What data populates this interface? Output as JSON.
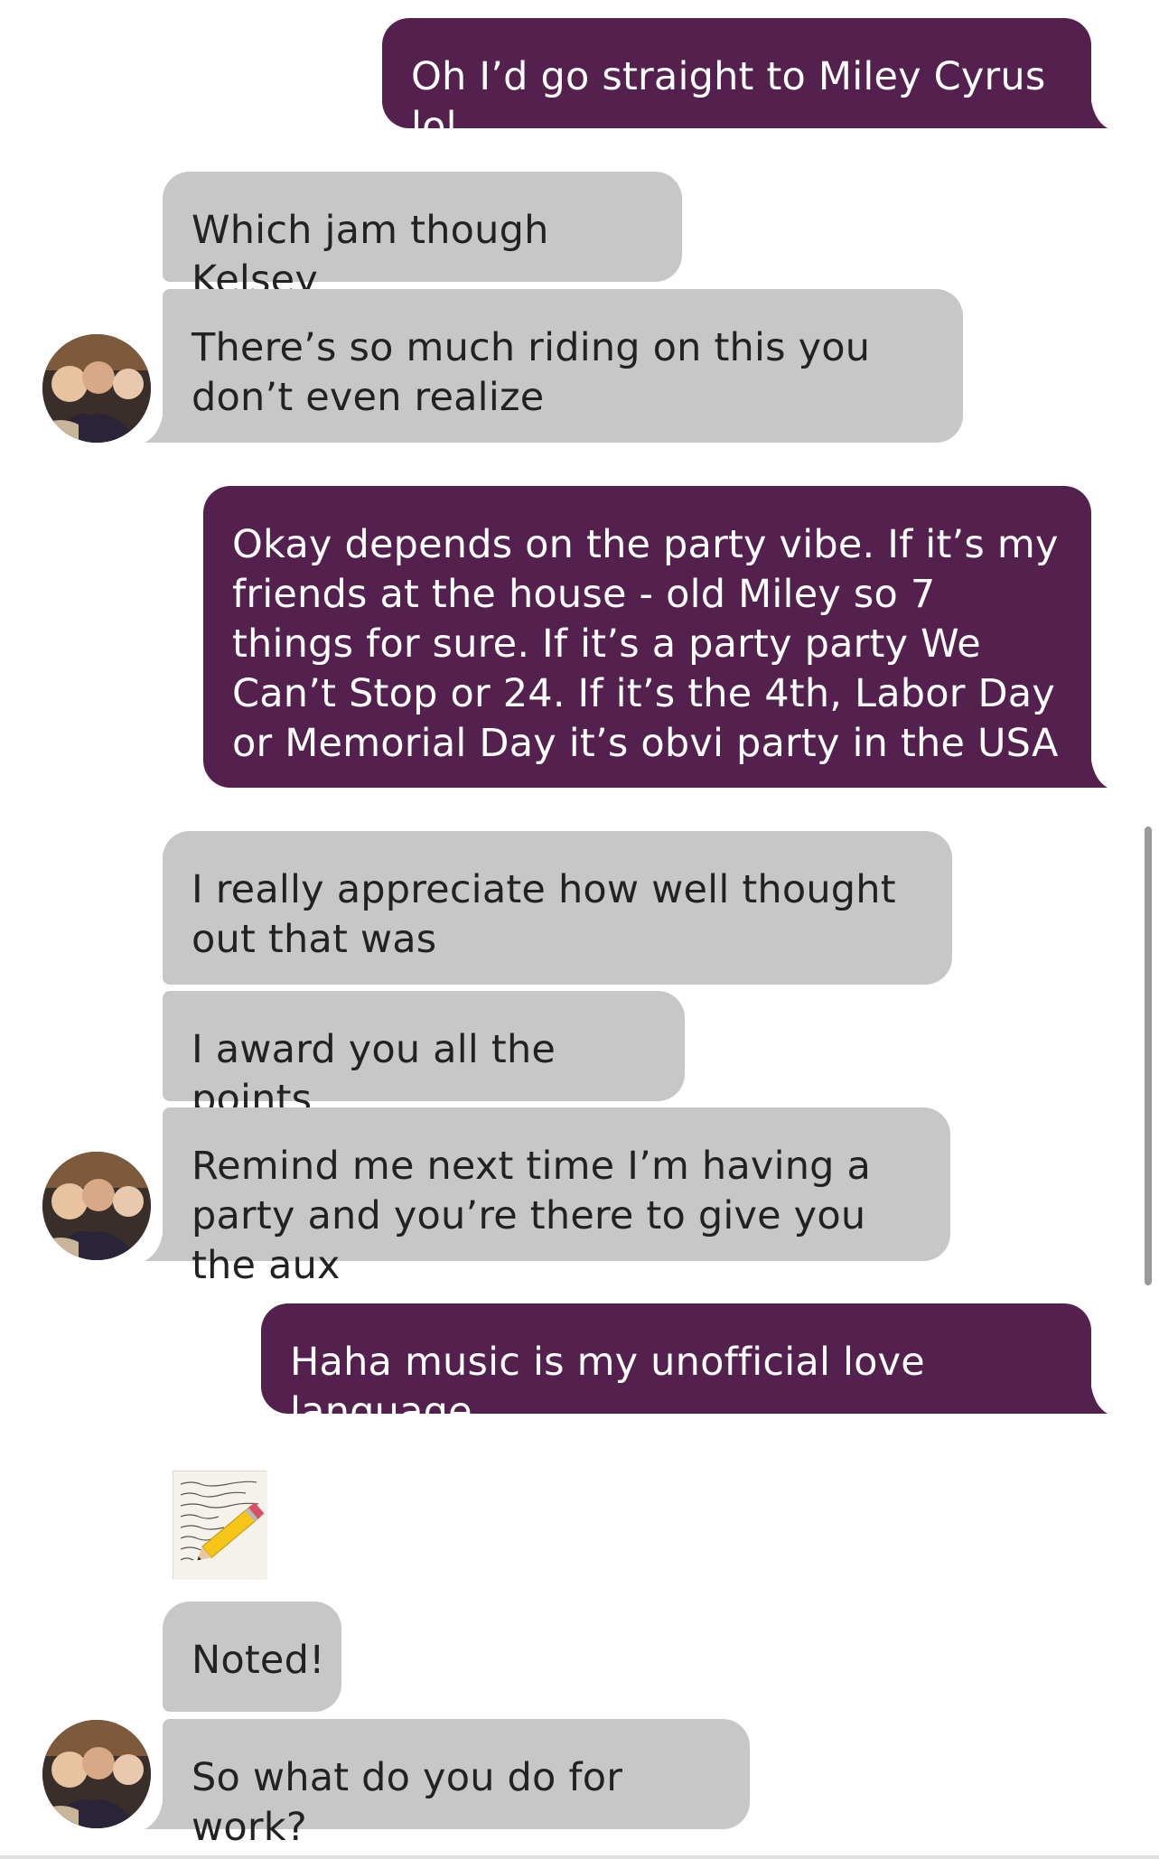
{
  "conversation": {
    "messages": [
      {
        "from": "me",
        "text": "Oh I’d go straight to Miley Cyrus lol"
      },
      {
        "from": "them",
        "text": "Which jam though Kelsey"
      },
      {
        "from": "them",
        "text": "There’s so much riding on this you don’t even realize"
      },
      {
        "from": "me",
        "text": "Okay depends on the party vibe. If it’s my friends at the house - old Miley so 7 things for sure. If it’s a party party We Can’t Stop or 24. If it’s the 4th, Labor Day or Memorial Day it’s obvi party in the USA"
      },
      {
        "from": "them",
        "text": "I really appreciate how well thought out that was"
      },
      {
        "from": "them",
        "text": "I award you all the points"
      },
      {
        "from": "them",
        "text": "Remind me next time I’m having a party and you’re there to give you the aux"
      },
      {
        "from": "me",
        "text": "Haha music is my unofficial love language"
      },
      {
        "from": "them",
        "text": "Noted!"
      },
      {
        "from": "them",
        "text": "So what do you do for work?"
      }
    ],
    "sticker": {
      "icon": "memo-pencil-icon"
    }
  },
  "colors": {
    "sent_bubble": "#54204d",
    "received_bubble": "#c7c7c7",
    "sent_text": "#ffffff",
    "received_text": "#222222"
  }
}
